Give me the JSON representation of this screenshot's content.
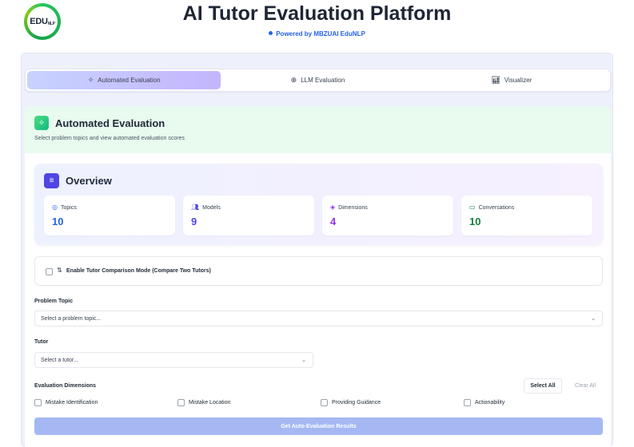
{
  "header": {
    "logo_text": "EDU",
    "logo_sub": "NLP",
    "title": "AI Tutor Evaluation Platform",
    "subtitle": "Powered by MBZUAI EduNLP"
  },
  "tabs": [
    {
      "label": "Automated Evaluation",
      "icon": "sparkle-icon",
      "active": true
    },
    {
      "label": "LLM Evaluation",
      "icon": "brain-icon",
      "active": false
    },
    {
      "label": "Visualizer",
      "icon": "bar-chart-icon",
      "active": false
    }
  ],
  "panel": {
    "title": "Automated Evaluation",
    "description": "Select problem topics and view automated evaluation scores"
  },
  "overview": {
    "title": "Overview",
    "stats": [
      {
        "label": "Topics",
        "value": "10",
        "icon": "target-icon",
        "color": "#2563eb"
      },
      {
        "label": "Models",
        "value": "9",
        "icon": "users-icon",
        "color": "#4f46e5"
      },
      {
        "label": "Dimensions",
        "value": "4",
        "icon": "layers-icon",
        "color": "#9333ea"
      },
      {
        "label": "Conversations",
        "value": "10",
        "icon": "chat-icon",
        "color": "#15803d"
      }
    ]
  },
  "comparison": {
    "label": "Enable Tutor Comparison Mode (Compare Two Tutors)",
    "checked": false
  },
  "problem_topic": {
    "label": "Problem Topic",
    "placeholder": "Select a problem topic..."
  },
  "tutor": {
    "label": "Tutor",
    "placeholder": "Select a tutor..."
  },
  "dimensions": {
    "label": "Evaluation Dimensions",
    "select_all": "Select All",
    "clear_all": "Clear All",
    "items": [
      {
        "label": "Mistake Identification",
        "checked": false
      },
      {
        "label": "Mistake Location",
        "checked": false
      },
      {
        "label": "Providing Guidance",
        "checked": false
      },
      {
        "label": "Actionability",
        "checked": false
      }
    ]
  },
  "submit_label": "Get Auto-Evaluation Results"
}
